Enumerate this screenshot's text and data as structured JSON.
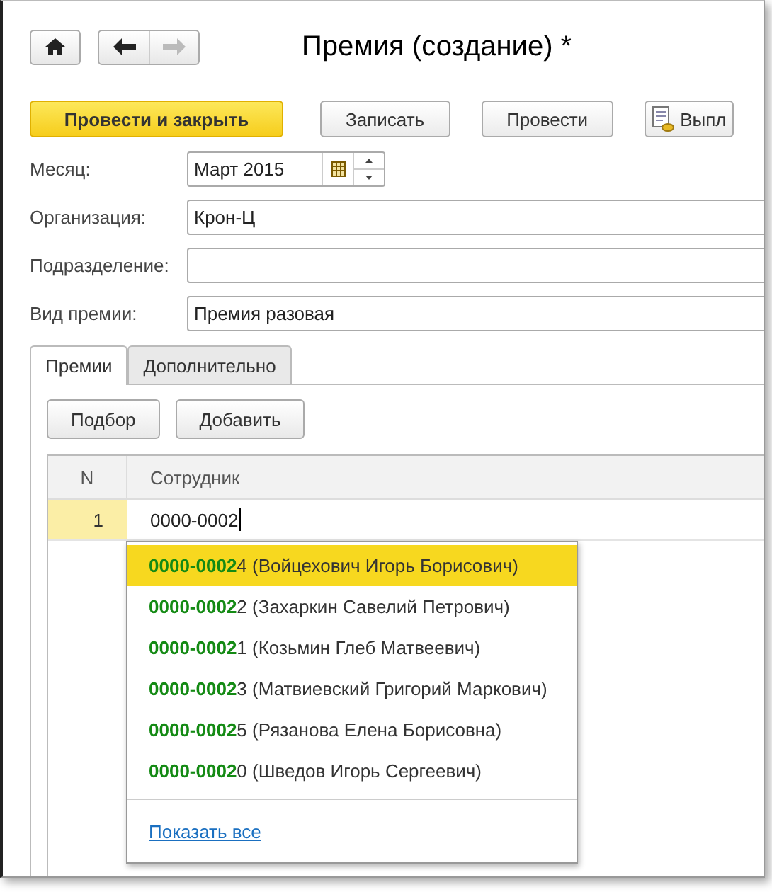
{
  "window": {
    "title": "Премия (создание) *"
  },
  "nav": {
    "back_enabled": true,
    "forward_enabled": false
  },
  "toolbar": [
    {
      "label": "Провести и закрыть",
      "kind": "primary"
    },
    {
      "label": "Записать",
      "kind": "normal"
    },
    {
      "label": "Провести",
      "kind": "normal"
    },
    {
      "label": "Выпл",
      "kind": "report"
    }
  ],
  "fields": [
    {
      "label": "Месяц:",
      "value": "Март 2015",
      "kind": "period"
    },
    {
      "label": "Организация:",
      "value": "Крон-Ц",
      "kind": "text"
    },
    {
      "label": "Подразделение:",
      "kind": "text"
    },
    {
      "label": "Вид премии:",
      "value": "Премия разовая",
      "kind": "text"
    }
  ],
  "tabs": [
    {
      "label": "Премии",
      "selected": true
    },
    {
      "label": "Дополнительно",
      "selected": false
    }
  ],
  "table_buttons": [
    "Подбор",
    "Добавить"
  ],
  "table": {
    "columns": [
      "N",
      "Сотрудник"
    ],
    "rows": [
      {
        "n": "1",
        "employee": "0000-0002",
        "selected": true
      }
    ]
  },
  "suggestions": {
    "items": [
      {
        "text": "**0000-0002**4 (Войцехович Игорь Борисович)",
        "selected": true
      },
      {
        "text": "**0000-0002**2 (Захаркин Савелий Петрович)",
        "selected": false
      },
      {
        "text": "**0000-0002**1 (Козьмин Глеб Матвеевич)",
        "selected": false
      },
      {
        "text": "**0000-0002**3 (Матвиевский Григорий Маркович)",
        "selected": false
      },
      {
        "text": "**0000-0002**5 (Рязанова Елена Борисовна)",
        "selected": false
      },
      {
        "text": "**0000-0002**0 (Шведов Игорь Сергеевич)",
        "selected": false
      }
    ],
    "show_all": "Показать все"
  }
}
